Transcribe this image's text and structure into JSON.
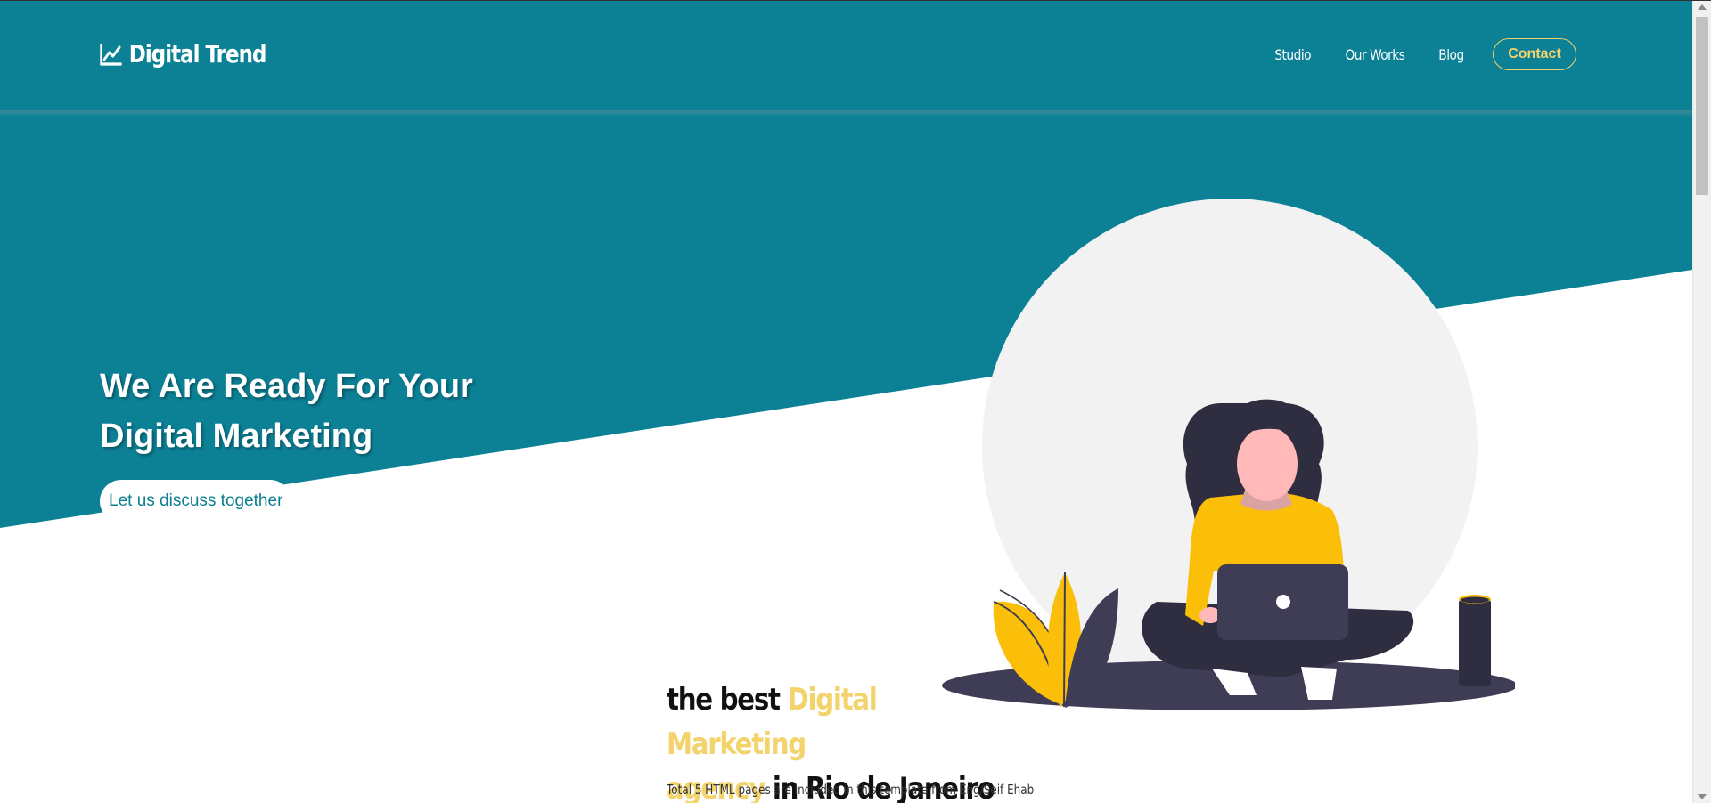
{
  "nav": {
    "brand": "Digital Trend",
    "brand_icon": "chart-line-icon",
    "links": [
      "Studio",
      "Our Works",
      "Blog"
    ],
    "contact": "Contact"
  },
  "hero": {
    "title_line1": "We Are Ready For Your",
    "title_line2": "Digital Marketing",
    "button": "Let us discuss together",
    "illustration": "woman-with-laptop-illustration"
  },
  "about": {
    "t1": "the best ",
    "t2": "Digital Marketing",
    "t3": "agency",
    "t4": " in Rio de Janeiro",
    "description": "Total 5 HTML pages are included in this template from Eng/Seif Ehab"
  },
  "colors": {
    "primary": "#0c8196",
    "accent": "#f3d36b",
    "illustration_yellow": "#fbbf0a",
    "illustration_dark": "#3f3d56",
    "circle": "#f2f2f2"
  }
}
